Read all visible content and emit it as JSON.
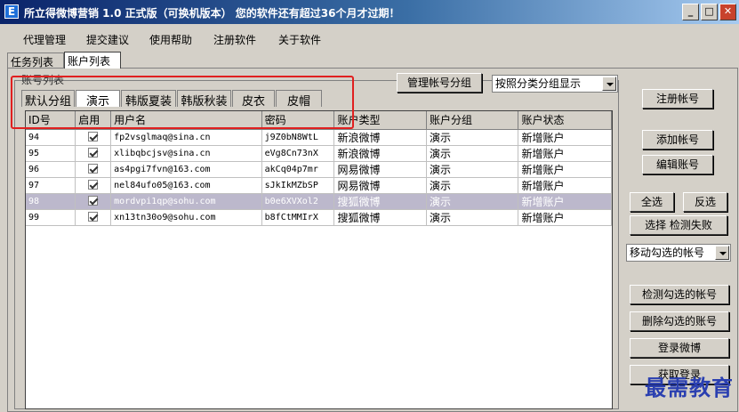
{
  "window": {
    "title": "所立得微博营销 1.0 正式版（可换机版本） 您的软件还有超过36个月才过期！",
    "app_icon": "E",
    "minimize_glyph": "_",
    "maximize_glyph": "□",
    "close_glyph": "✕"
  },
  "menu": [
    "代理管理",
    "提交建议",
    "使用帮助",
    "注册软件",
    "关于软件"
  ],
  "outer_tabs": [
    {
      "label": "任务列表",
      "active": false
    },
    {
      "label": "账户列表",
      "active": true
    }
  ],
  "account_group": {
    "title": "账号列表",
    "manage_button": "管理帐号分组",
    "display_mode": "按照分类分组显示"
  },
  "inner_tabs": [
    {
      "label": "默认分组",
      "active": false
    },
    {
      "label": "演示",
      "active": true
    },
    {
      "label": "韩版夏装",
      "active": false
    },
    {
      "label": "韩版秋装",
      "active": false
    },
    {
      "label": "皮衣",
      "active": false
    },
    {
      "label": "皮帽",
      "active": false
    }
  ],
  "table": {
    "columns": [
      "ID号",
      "启用",
      "用户名",
      "密码",
      "账户类型",
      "账户分组",
      "账户状态"
    ],
    "rows": [
      {
        "id": "94",
        "enabled": true,
        "username": "fp2vsglmaq@sina.cn",
        "password": "j9Z0bN8WtL",
        "type": "新浪微博",
        "group": "演示",
        "status": "新增账户",
        "selected": false
      },
      {
        "id": "95",
        "enabled": true,
        "username": "xlibqbcjsv@sina.cn",
        "password": "eVg8Cn73nX",
        "type": "新浪微博",
        "group": "演示",
        "status": "新增账户",
        "selected": false
      },
      {
        "id": "96",
        "enabled": true,
        "username": "as4pgi7fvn@163.com",
        "password": "akCq04p7mr",
        "type": "网易微博",
        "group": "演示",
        "status": "新增账户",
        "selected": false
      },
      {
        "id": "97",
        "enabled": true,
        "username": "nel84ufo05@163.com",
        "password": "sJkIkMZbSP",
        "type": "网易微博",
        "group": "演示",
        "status": "新增账户",
        "selected": false
      },
      {
        "id": "98",
        "enabled": true,
        "username": "mordvpi1qp@sohu.com",
        "password": "b0e6XVXol2",
        "type": "搜狐微博",
        "group": "演示",
        "status": "新增账户",
        "selected": true
      },
      {
        "id": "99",
        "enabled": true,
        "username": "xn13tn30o9@sohu.com",
        "password": "b8fCtMMIrX",
        "type": "搜狐微博",
        "group": "演示",
        "status": "新增账户",
        "selected": false
      }
    ]
  },
  "side_buttons": {
    "register": "注册帐号",
    "add": "添加帐号",
    "edit": "编辑账号",
    "select_all": "全选",
    "invert": "反选",
    "select_failed": "选择 检测失败",
    "move_checked": "移动勾选的帐号",
    "check_checked": "检测勾选的帐号",
    "delete_checked": "删除勾选的账号",
    "login": "登录微博",
    "partial": "获取登录"
  },
  "watermark": "最需教育",
  "colors": {
    "title_gradient_start": "#0a246a",
    "title_gradient_end": "#a6caf0",
    "highlight_box": "#e02020",
    "selected_row": "#bcb8cc"
  }
}
